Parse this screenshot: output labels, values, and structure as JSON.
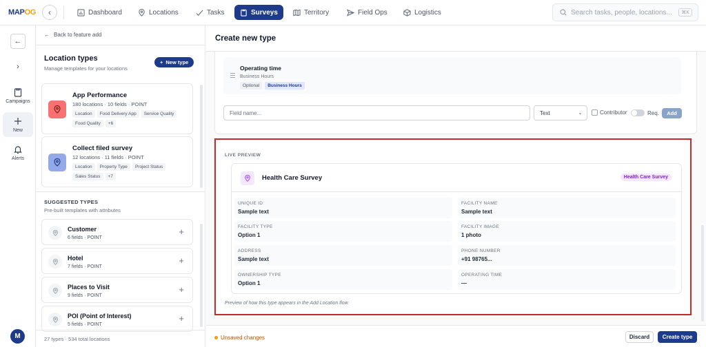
{
  "app": {
    "logo_main": "MAP",
    "logo_accent": "OG"
  },
  "nav": [
    {
      "label": "Dashboard",
      "icon": "bar-chart-icon",
      "active": false
    },
    {
      "label": "Locations",
      "icon": "map-pin-icon",
      "active": false
    },
    {
      "label": "Tasks",
      "icon": "check-icon",
      "active": false
    },
    {
      "label": "Surveys",
      "icon": "clipboard-icon",
      "active": true
    },
    {
      "label": "Territory",
      "icon": "map-icon",
      "active": false
    },
    {
      "label": "Field Ops",
      "icon": "send-icon",
      "active": false
    },
    {
      "label": "Logistics",
      "icon": "box-icon",
      "active": false
    }
  ],
  "search": {
    "placeholder": "Search tasks, people, locations...",
    "shortcut": "⌘K"
  },
  "rail": {
    "items": [
      {
        "label": "Campaigns",
        "icon": "clipboard-icon"
      },
      {
        "label": "New",
        "icon": "plus-icon"
      },
      {
        "label": "Alerts",
        "icon": "bell-icon"
      }
    ],
    "avatar": "M"
  },
  "left": {
    "back_label": "Back to feature add",
    "title": "Location types",
    "subtitle": "Manage templates for your locations",
    "new_type": "New type",
    "types": [
      {
        "name": "App Performance",
        "meta": "180 locations · 10 fields · POINT",
        "color": "#f87171",
        "tags": [
          "Location",
          "Food Delivery App",
          "Service Quality",
          "Food Quality",
          "+6"
        ]
      },
      {
        "name": "Collect filed survey",
        "meta": "12 locations · 11 fields · POINT",
        "color": "#93a9e8",
        "tags": [
          "Location",
          "Property Type",
          "Project Status",
          "Sales Status",
          "+7"
        ]
      }
    ],
    "suggested_title": "SUGGESTED TYPES",
    "suggested_sub": "Pre-built templates with attributes",
    "suggested": [
      {
        "name": "Customer",
        "meta": "6 fields · POINT"
      },
      {
        "name": "Hotel",
        "meta": "7 fields · POINT"
      },
      {
        "name": "Places to Visit",
        "meta": "9 fields · POINT"
      },
      {
        "name": "POI (Point of Interest)",
        "meta": "5 fields · POINT"
      }
    ],
    "footer": "27 types · 534 total locations"
  },
  "main": {
    "title": "Create new type",
    "operating": {
      "name": "Operating time",
      "sub": "Business Hours",
      "tag_optional": "Optional",
      "tag_type": "Business Hours"
    },
    "field_placeholder": "Field name...",
    "type_value": "Text",
    "contributor_label": "Contributor",
    "req_label": "Req.",
    "add_label": "Add",
    "preview": {
      "label": "LIVE PREVIEW",
      "name": "Health Care Survey",
      "badge": "Health Care Survey",
      "fields": [
        {
          "label": "UNIQUE ID",
          "value": "Sample text"
        },
        {
          "label": "FACILITY NAME",
          "value": "Sample text"
        },
        {
          "label": "FACILITY TYPE",
          "value": "Option 1"
        },
        {
          "label": "FACILITY IMAGE",
          "value": "1 photo"
        },
        {
          "label": "ADDRESS",
          "value": "Sample text"
        },
        {
          "label": "PHONE NUMBER",
          "value": "+91 98765..."
        },
        {
          "label": "OWNERSHIP TYPE",
          "value": "Option 1"
        },
        {
          "label": "OPERATING TIME",
          "value": "—"
        }
      ],
      "footnote": "Preview of how this type appears in the Add Location flow."
    },
    "unsaved": "Unsaved changes",
    "discard": "Discard",
    "create": "Create type"
  }
}
